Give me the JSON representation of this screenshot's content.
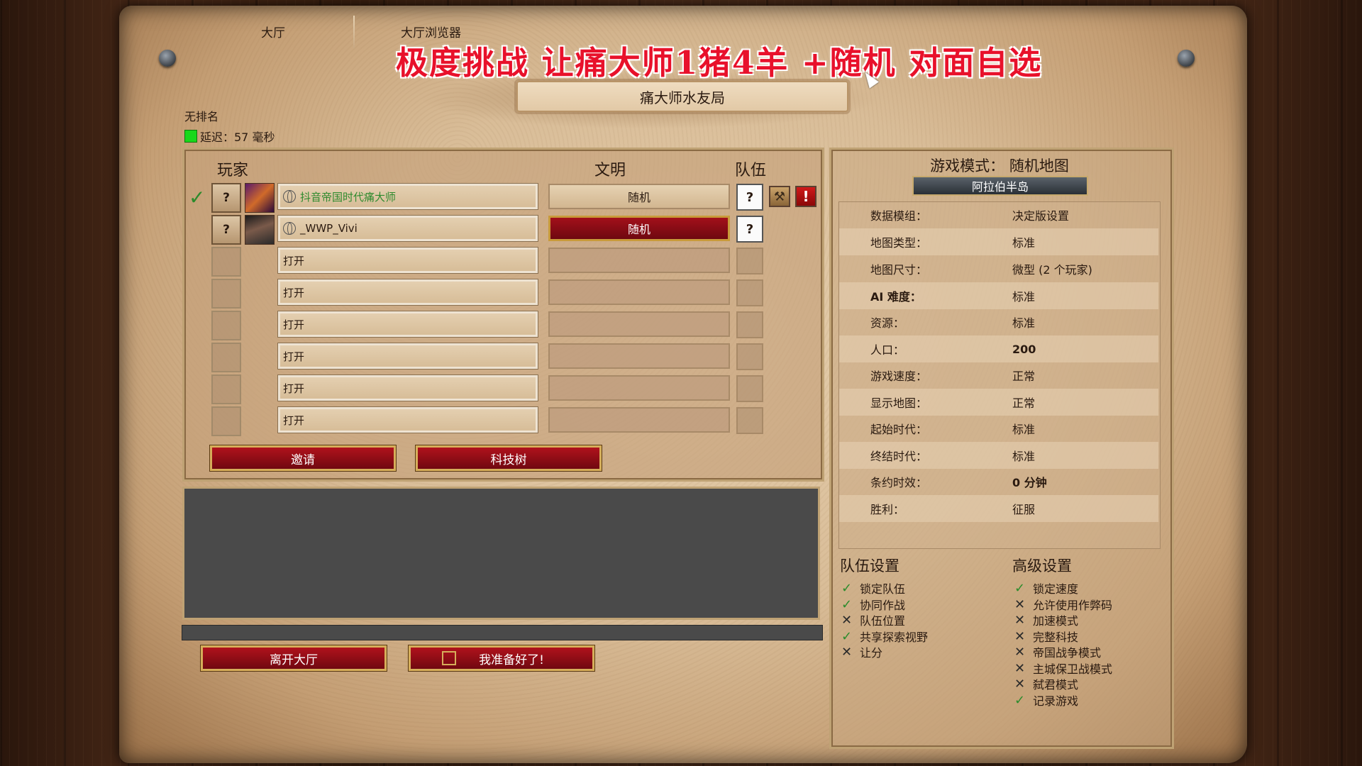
{
  "tabs": {
    "lobby": "大厅",
    "browser": "大厅浏览器"
  },
  "overlay_title": "极度挑战   让痛大师1猪4羊 +随机 对面自选",
  "lobby_name": "痛大师水友局",
  "status": {
    "ranked": "无排名",
    "ping": "延迟：57 毫秒"
  },
  "player_headers": {
    "player": "玩家",
    "civ": "文明",
    "team": "队伍"
  },
  "players": [
    {
      "slot": "?",
      "name": "抖音帝国时代痛大师",
      "civ": "随机",
      "team": "?"
    },
    {
      "slot": "?",
      "name": "_WWP_Vivi",
      "civ": "随机",
      "team": "?"
    },
    {
      "name": "打开"
    },
    {
      "name": "打开"
    },
    {
      "name": "打开"
    },
    {
      "name": "打开"
    },
    {
      "name": "打开"
    },
    {
      "name": "打开"
    }
  ],
  "buttons": {
    "invite": "邀请",
    "tech_tree": "科技树",
    "leave": "离开大厅",
    "ready": "我准备好了!"
  },
  "game_mode": {
    "label": "游戏模式：",
    "value": "随机地图",
    "map": "阿拉伯半岛"
  },
  "settings": [
    {
      "label": "数据模组：",
      "value": "决定版设置"
    },
    {
      "label": "地图类型：",
      "value": "标准"
    },
    {
      "label": "地图尺寸：",
      "value": "微型 (2 个玩家)"
    },
    {
      "label": "AI 难度：",
      "value": "标准"
    },
    {
      "label": "资源：",
      "value": "标准"
    },
    {
      "label": "人口：",
      "value": "200"
    },
    {
      "label": "游戏速度：",
      "value": "正常"
    },
    {
      "label": "显示地图：",
      "value": "正常"
    },
    {
      "label": "起始时代：",
      "value": "标准"
    },
    {
      "label": "终结时代：",
      "value": "标准"
    },
    {
      "label": "条约时效：",
      "value": "0 分钟"
    },
    {
      "label": "胜利：",
      "value": "征服"
    }
  ],
  "team_settings": {
    "title": "队伍设置",
    "items": [
      {
        "label": "锁定队伍",
        "on": true
      },
      {
        "label": "协同作战",
        "on": true
      },
      {
        "label": "队伍位置",
        "on": false
      },
      {
        "label": "共享探索视野",
        "on": true
      },
      {
        "label": "让分",
        "on": false
      }
    ]
  },
  "advanced_settings": {
    "title": "高级设置",
    "items": [
      {
        "label": "锁定速度",
        "on": true
      },
      {
        "label": "允许使用作弊码",
        "on": false
      },
      {
        "label": "加速模式",
        "on": false
      },
      {
        "label": "完整科技",
        "on": false
      },
      {
        "label": "帝国战争模式",
        "on": false
      },
      {
        "label": "主城保卫战模式",
        "on": false
      },
      {
        "label": "弑君模式",
        "on": false
      },
      {
        "label": "记录游戏",
        "on": true
      }
    ]
  },
  "colors": {
    "check": "#2c8c2c",
    "red_button": "#a3101a",
    "ping": "#18d81a",
    "overlay": "#e8112b"
  }
}
